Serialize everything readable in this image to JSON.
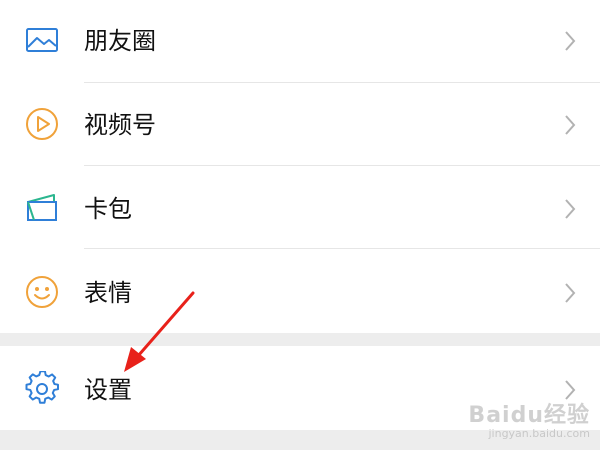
{
  "menu": {
    "items": [
      {
        "label": "朋友圈",
        "icon": "moments-icon"
      },
      {
        "label": "视频号",
        "icon": "channels-play-icon"
      },
      {
        "label": "卡包",
        "icon": "card-wallet-icon"
      },
      {
        "label": "表情",
        "icon": "sticker-smile-icon"
      }
    ],
    "settings": {
      "label": "设置",
      "icon": "gear-icon"
    }
  },
  "watermark": {
    "brand": "Baidu经验",
    "url": "jingyan.baidu.com"
  },
  "colors": {
    "blue": "#2f7fd8",
    "orange": "#f0a23a",
    "green": "#2bb68f",
    "arrow": "#e8211a",
    "divider": "#e6e6e6",
    "gap": "#ededed",
    "chevron": "#b2b2b2"
  }
}
